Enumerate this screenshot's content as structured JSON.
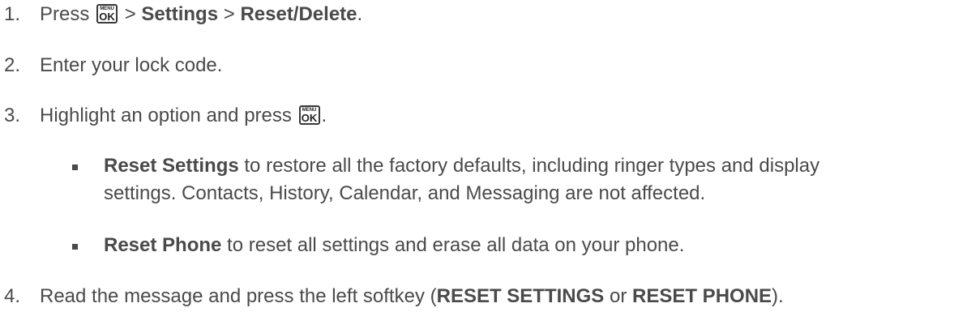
{
  "menu_key": {
    "top": "MENU",
    "bottom": "OK"
  },
  "steps": [
    {
      "num": "1.",
      "press": "Press",
      "sep1": ">",
      "settings": "Settings",
      "sep2": ">",
      "reset_delete": "Reset/Delete",
      "end": "."
    },
    {
      "num": "2.",
      "text": "Enter your lock code."
    },
    {
      "num": "3.",
      "text": "Highlight an option and press",
      "end": "."
    },
    {
      "num": "4.",
      "text": "Read the message and press the left softkey (",
      "opt1": "RESET SETTINGS",
      "or": "or",
      "opt2": "RESET PHONE",
      "end": ")."
    }
  ],
  "options": [
    {
      "title": "Reset Settings",
      "line1": "to restore all the factory defaults, including ringer types and display",
      "line2": "settings. Contacts, History, Calendar, and Messaging are not affected."
    },
    {
      "title": "Reset Phone",
      "line1": "to reset all settings and erase all data on your phone."
    }
  ]
}
